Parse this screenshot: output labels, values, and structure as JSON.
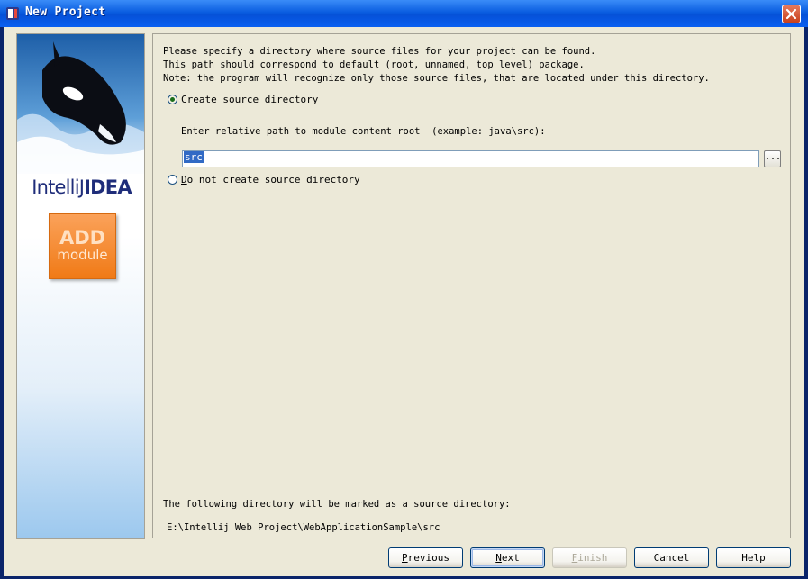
{
  "window": {
    "title": "New Project",
    "icon": "intellij-app-icon",
    "close_icon": "close-icon"
  },
  "sidebar": {
    "brand_light": "IntelliJ",
    "brand_bold": "IDEA",
    "badge_line1": "ADD",
    "badge_line2": "module"
  },
  "description": {
    "line1": "Please specify a directory where source files for your project can be found.",
    "line2": "This path should correspond to default (root, unnamed, top level) package.",
    "line3": "Note: the program will recognize only those source files, that are located under this directory."
  },
  "options": {
    "create": {
      "mnemonic": "C",
      "rest": "reate source directory",
      "checked": true
    },
    "no_create": {
      "mnemonic": "D",
      "rest": "o not create source directory",
      "checked": false
    }
  },
  "relative_path": {
    "hint": "Enter relative path to module content root  (example: java\\src):",
    "value": "src",
    "browse_label": "..."
  },
  "footer": {
    "label": "The following directory will be marked as a source directory:",
    "path": "E:\\Intellij Web Project\\WebApplicationSample\\src"
  },
  "buttons": {
    "previous": {
      "mnemonic": "P",
      "rest": "revious",
      "enabled": true
    },
    "next": {
      "mnemonic": "N",
      "rest": "ext",
      "enabled": true,
      "default": true
    },
    "finish": {
      "mnemonic": "F",
      "rest": "inish",
      "enabled": false
    },
    "cancel": {
      "label": "Cancel",
      "enabled": true
    },
    "help": {
      "label": "Help",
      "enabled": true
    }
  },
  "colors": {
    "titlebar": "#0a5de0",
    "dialog_bg": "#ece9d8",
    "selection": "#316ac5",
    "badge_orange": "#f07a16",
    "brand_text": "#1f2d7a"
  }
}
